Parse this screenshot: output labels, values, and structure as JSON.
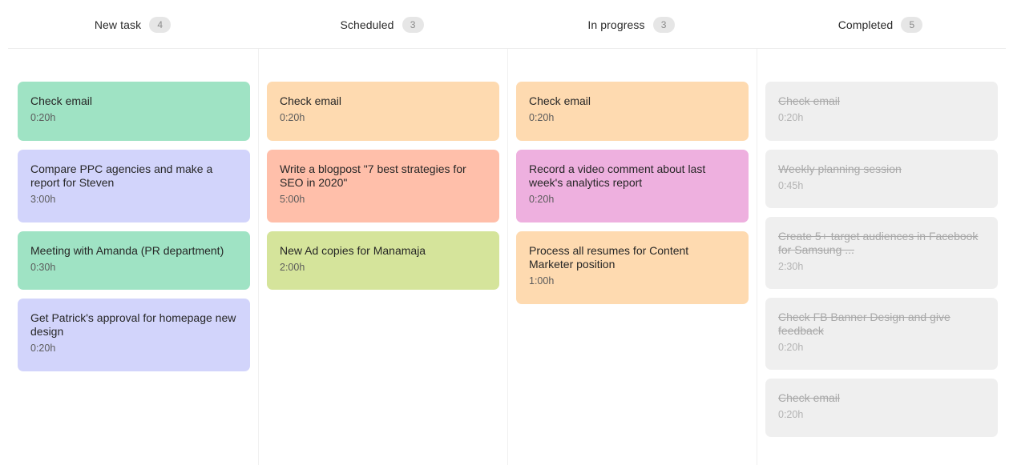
{
  "columns": [
    {
      "title": "New task",
      "count": "4",
      "cards": [
        {
          "title": "Check email",
          "time": "0:20h",
          "color": "#9fe3c4"
        },
        {
          "title": "Compare PPC agencies and make a report for Steven",
          "time": "3:00h",
          "color": "#d2d4fb"
        },
        {
          "title": "Meeting with Amanda (PR department)",
          "time": "0:30h",
          "color": "#9fe3c4"
        },
        {
          "title": "Get Patrick's approval for homepage new design",
          "time": "0:20h",
          "color": "#d2d4fb"
        }
      ]
    },
    {
      "title": "Scheduled",
      "count": "3",
      "cards": [
        {
          "title": "Check email",
          "time": "0:20h",
          "color": "#fedab0"
        },
        {
          "title": "Write a blogpost \"7 best strategies for SEO in 2020\"",
          "time": "5:00h",
          "color": "#ffbfaa"
        },
        {
          "title": "New Ad copies for Manamaja",
          "time": "2:00h",
          "color": "#d5e49b"
        }
      ]
    },
    {
      "title": "In progress",
      "count": "3",
      "cards": [
        {
          "title": "Check email",
          "time": "0:20h",
          "color": "#fedab0"
        },
        {
          "title": "Record a video comment about last week's analytics report",
          "time": "0:20h",
          "color": "#eeb0df"
        },
        {
          "title": "Process all resumes for Content Marketer position",
          "time": "1:00h",
          "color": "#fedab0"
        }
      ]
    },
    {
      "title": "Completed",
      "count": "5",
      "cards": [
        {
          "title": "Check email",
          "time": "0:20h",
          "color": "#efefef"
        },
        {
          "title": "Weekly planning session",
          "time": "0:45h",
          "color": "#efefef"
        },
        {
          "title": "Create 5+ target audiences in Facebook for Samsung ...",
          "time": "2:30h",
          "color": "#efefef"
        },
        {
          "title": "Check FB Banner Design and give feedback",
          "time": "0:20h",
          "color": "#efefef"
        },
        {
          "title": "Check email",
          "time": "0:20h",
          "color": "#efefef"
        }
      ]
    }
  ]
}
